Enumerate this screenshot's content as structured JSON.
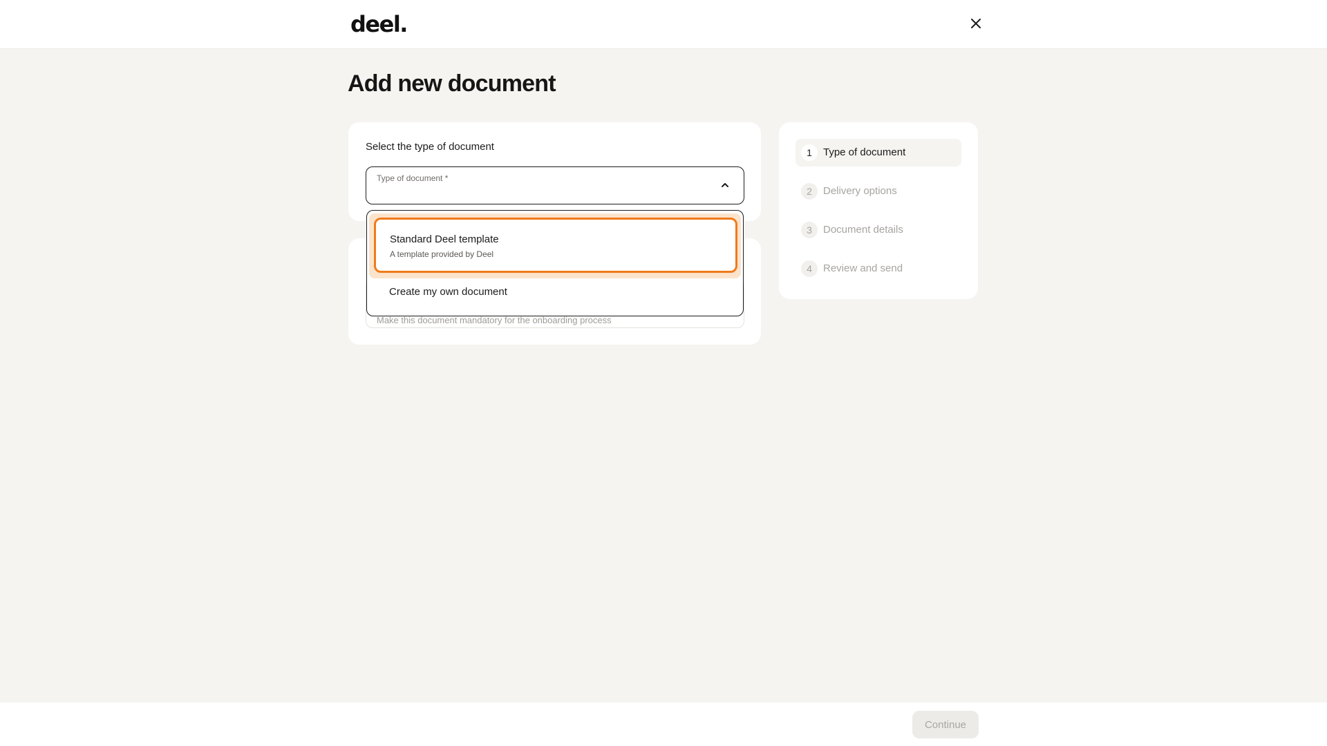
{
  "header": {
    "logo_text": "deel.",
    "close_icon": "close-icon"
  },
  "page": {
    "title": "Add new document"
  },
  "document_type": {
    "section_label": "Select the type of document",
    "field_label": "Type of document *",
    "field_value": "",
    "chevron_icon": "chevron-up-icon",
    "options": [
      {
        "title": "Standard Deel template",
        "subtitle": "A template provided by Deel",
        "highlighted": true
      },
      {
        "title": "Create my own document",
        "subtitle": ""
      }
    ]
  },
  "second_card": {
    "helper_text": "Make this document mandatory for the onboarding process"
  },
  "steps": [
    {
      "number": "1",
      "label": "Type of document",
      "active": true
    },
    {
      "number": "2",
      "label": "Delivery options",
      "active": false
    },
    {
      "number": "3",
      "label": "Document details",
      "active": false
    },
    {
      "number": "4",
      "label": "Review and send",
      "active": false
    }
  ],
  "footer": {
    "continue_label": "Continue",
    "continue_disabled": true
  },
  "colors": {
    "accent_focus": "#f07a1a",
    "highlight_bg": "#fbe3cc",
    "page_bg": "#f5f4f1"
  }
}
